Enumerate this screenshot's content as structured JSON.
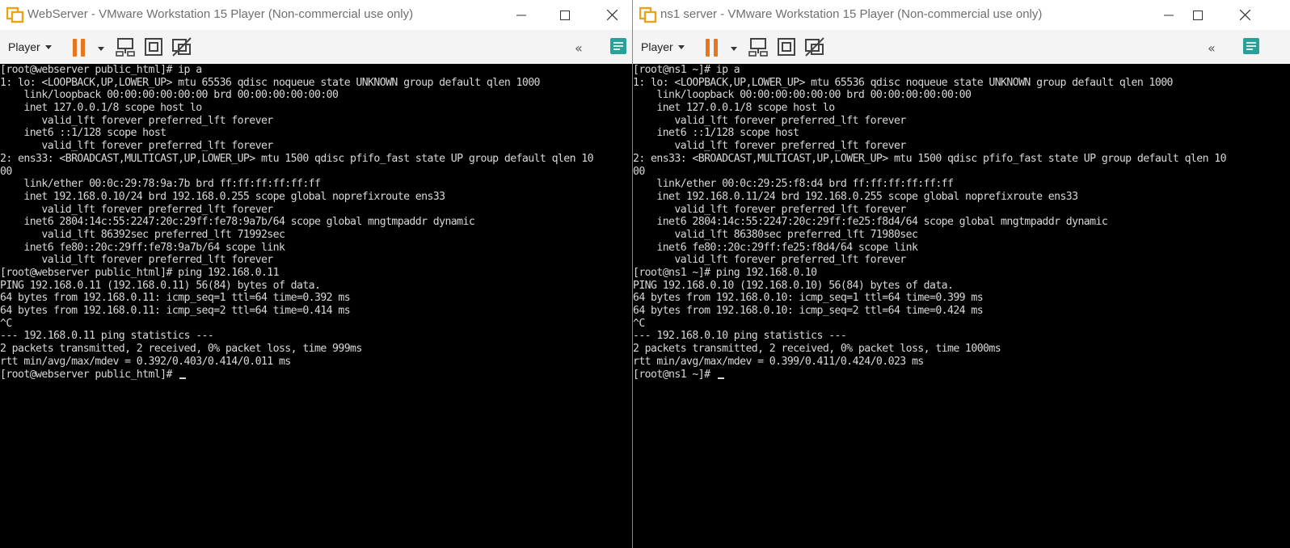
{
  "windows": [
    {
      "title": "WebServer - VMware Workstation 15 Player (Non-commercial use only)",
      "toolbar": {
        "player_label": "Player"
      },
      "terminal_lines": [
        "[root@webserver public_html]# ip a",
        "1: lo: <LOOPBACK,UP,LOWER_UP> mtu 65536 qdisc noqueue state UNKNOWN group default qlen 1000",
        "    link/loopback 00:00:00:00:00:00 brd 00:00:00:00:00:00",
        "    inet 127.0.0.1/8 scope host lo",
        "       valid_lft forever preferred_lft forever",
        "    inet6 ::1/128 scope host",
        "       valid_lft forever preferred_lft forever",
        "2: ens33: <BROADCAST,MULTICAST,UP,LOWER_UP> mtu 1500 qdisc pfifo_fast state UP group default qlen 10",
        "00",
        "    link/ether 00:0c:29:78:9a:7b brd ff:ff:ff:ff:ff:ff",
        "    inet 192.168.0.10/24 brd 192.168.0.255 scope global noprefixroute ens33",
        "       valid_lft forever preferred_lft forever",
        "    inet6 2804:14c:55:2247:20c:29ff:fe78:9a7b/64 scope global mngtmpaddr dynamic",
        "       valid_lft 86392sec preferred_lft 71992sec",
        "    inet6 fe80::20c:29ff:fe78:9a7b/64 scope link",
        "       valid_lft forever preferred_lft forever",
        "[root@webserver public_html]# ping 192.168.0.11",
        "PING 192.168.0.11 (192.168.0.11) 56(84) bytes of data.",
        "64 bytes from 192.168.0.11: icmp_seq=1 ttl=64 time=0.392 ms",
        "64 bytes from 192.168.0.11: icmp_seq=2 ttl=64 time=0.414 ms",
        "^C",
        "--- 192.168.0.11 ping statistics ---",
        "2 packets transmitted, 2 received, 0% packet loss, time 999ms",
        "rtt min/avg/max/mdev = 0.392/0.403/0.414/0.011 ms",
        "[root@webserver public_html]# "
      ]
    },
    {
      "title": "ns1 server - VMware Workstation 15 Player (Non-commercial use only)",
      "toolbar": {
        "player_label": "Player"
      },
      "terminal_lines": [
        "[root@ns1 ~]# ip a",
        "1: lo: <LOOPBACK,UP,LOWER_UP> mtu 65536 qdisc noqueue state UNKNOWN group default qlen 1000",
        "    link/loopback 00:00:00:00:00:00 brd 00:00:00:00:00:00",
        "    inet 127.0.0.1/8 scope host lo",
        "       valid_lft forever preferred_lft forever",
        "    inet6 ::1/128 scope host",
        "       valid_lft forever preferred_lft forever",
        "2: ens33: <BROADCAST,MULTICAST,UP,LOWER_UP> mtu 1500 qdisc pfifo_fast state UP group default qlen 10",
        "00",
        "    link/ether 00:0c:29:25:f8:d4 brd ff:ff:ff:ff:ff:ff",
        "    inet 192.168.0.11/24 brd 192.168.0.255 scope global noprefixroute ens33",
        "       valid_lft forever preferred_lft forever",
        "    inet6 2804:14c:55:2247:20c:29ff:fe25:f8d4/64 scope global mngtmpaddr dynamic",
        "       valid_lft 86380sec preferred_lft 71980sec",
        "    inet6 fe80::20c:29ff:fe25:f8d4/64 scope link",
        "       valid_lft forever preferred_lft forever",
        "[root@ns1 ~]# ping 192.168.0.10",
        "PING 192.168.0.10 (192.168.0.10) 56(84) bytes of data.",
        "64 bytes from 192.168.0.10: icmp_seq=1 ttl=64 time=0.399 ms",
        "64 bytes from 192.168.0.10: icmp_seq=2 ttl=64 time=0.424 ms",
        "^C",
        "--- 192.168.0.10 ping statistics ---",
        "2 packets transmitted, 2 received, 0% packet loss, time 1000ms",
        "rtt min/avg/max/mdev = 0.399/0.411/0.424/0.023 ms",
        "[root@ns1 ~]# "
      ]
    }
  ],
  "icons": {
    "app": "vmware-logo-icon",
    "minimize": "minimize-icon",
    "maximize": "maximize-icon",
    "close": "close-icon",
    "pause": "pause-icon",
    "send_keys": "send-ctrl-alt-del-icon",
    "fit_guest": "fit-guest-icon",
    "unity": "unity-icon",
    "collapse": "collapse-toolbar-icon",
    "notes": "notes-icon"
  },
  "colors": {
    "pause_accent": "#e8761f",
    "notes_accent": "#2aa198",
    "terminal_bg": "#000000",
    "terminal_fg": "#d8d8d8"
  }
}
